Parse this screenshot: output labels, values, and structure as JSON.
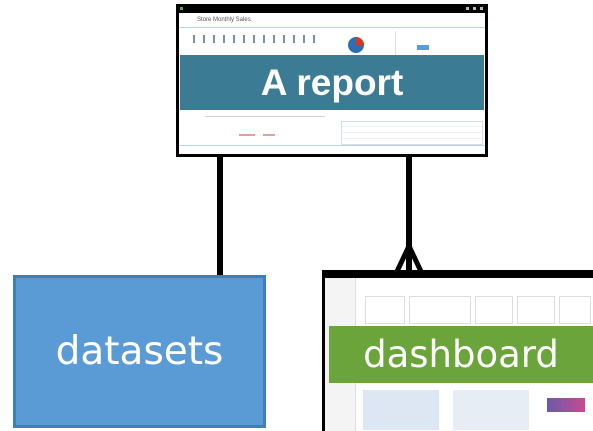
{
  "diagram": {
    "nodes": {
      "report": {
        "label": "A report",
        "color": "#3b7b93",
        "thumbnail_title": "Store Monthly Sales"
      },
      "datasets": {
        "label": "datasets",
        "color": "#5b9bd5"
      },
      "dashboard": {
        "label": "dashboard",
        "color": "#6aa43a"
      }
    },
    "edges": [
      {
        "from": "report",
        "to": "datasets",
        "relationship": "one"
      },
      {
        "from": "report",
        "to": "dashboard",
        "relationship": "many"
      }
    ]
  }
}
